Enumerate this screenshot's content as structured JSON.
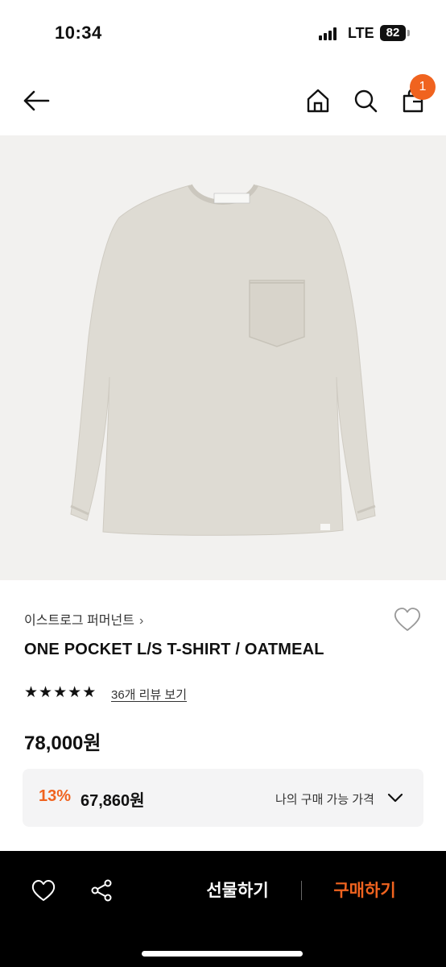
{
  "status_bar": {
    "time": "10:34",
    "network": "LTE",
    "battery": "82"
  },
  "header": {
    "cart_count": "1",
    "icons": [
      "back-arrow-icon",
      "home-icon",
      "search-icon",
      "shopping-bag-icon"
    ]
  },
  "product": {
    "image": "oatmeal long sleeve pocket t-shirt",
    "brand": "이스트로그 퍼머넌트",
    "brand_chevron": "›",
    "name": "ONE POCKET L/S T-SHIRT / OATMEAL",
    "rating_stars": 5,
    "review_link": "36개 리뷰 보기",
    "price": "78,000원"
  },
  "discount": {
    "rate": "13%",
    "price": "67,860원",
    "label": "나의 구매 가능 가격"
  },
  "bottom_bar": {
    "gift_label": "선물하기",
    "buy_label": "구매하기"
  },
  "colors": {
    "accent": "#f0631f",
    "bottom_bar_bg": "#000000",
    "image_bg": "#f2f1ef",
    "shirt": "#dedbd3"
  }
}
